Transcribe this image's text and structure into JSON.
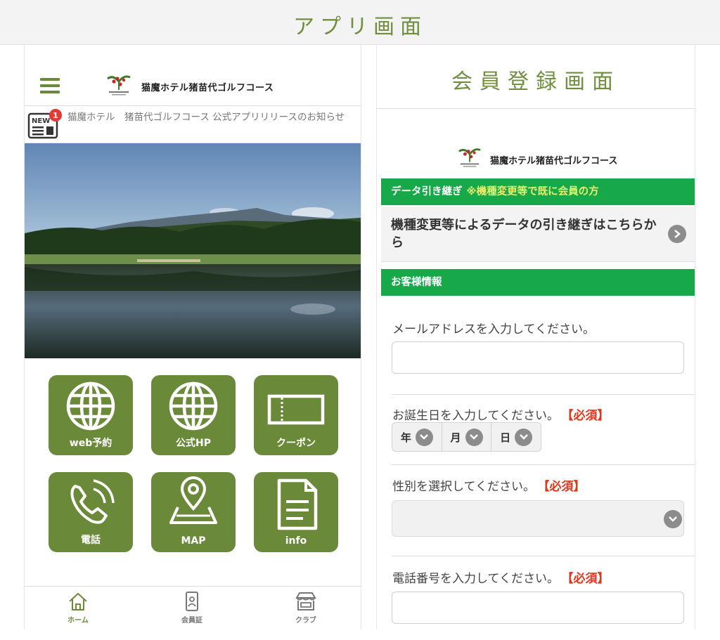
{
  "banner": {
    "title": "アプリ画面"
  },
  "left": {
    "brand": {
      "name": "猫魔ホテル猪苗代ゴルフコース",
      "logo_icon": "golf-brand-logo"
    },
    "news": {
      "icon": "newspaper-icon",
      "icon_text": "NEW",
      "badge": "1",
      "text": "猫魔ホテル　猪苗代ゴルフコース 公式アプリリリースのお知らせ"
    },
    "tiles": [
      {
        "label": "web予約",
        "icon": "globe-icon"
      },
      {
        "label": "公式HP",
        "icon": "globe-icon"
      },
      {
        "label": "クーポン",
        "icon": "ticket-icon"
      },
      {
        "label": "電話",
        "icon": "phone-icon"
      },
      {
        "label": "MAP",
        "icon": "map-pin-icon"
      },
      {
        "label": "info",
        "icon": "document-icon"
      }
    ],
    "nav": [
      {
        "label": "ホーム",
        "icon": "home-icon",
        "active": true
      },
      {
        "label": "会員証",
        "icon": "member-card-icon",
        "active": false
      },
      {
        "label": "クラブ",
        "icon": "store-icon",
        "active": false
      }
    ],
    "colors": {
      "accent": "#6a8a3a",
      "badge": "#e53935"
    }
  },
  "right": {
    "header": {
      "title": "会員登録画面"
    },
    "brand": {
      "name": "猫魔ホテル猪苗代ゴルフコース"
    },
    "transfer_section": {
      "title": "データ引き継ぎ",
      "note": "※機種変更等で既に会員の方",
      "link_text": "機種変更等によるデータの引き継ぎはこちらから"
    },
    "customer_section": {
      "title": "お客様情報"
    },
    "fields": {
      "email_label": "メールアドレスを入力してください。",
      "email_value": "",
      "birthday_label": "お誕生日を入力してください。",
      "year": "年",
      "month": "月",
      "day": "日",
      "gender_label": "性別を選択してください。",
      "gender_value": "",
      "phone_label": "電話番号を入力してください。",
      "phone_value": "",
      "required": "【必須】"
    },
    "colors": {
      "section_green": "#17a84a",
      "required_red": "#e0361a"
    }
  }
}
